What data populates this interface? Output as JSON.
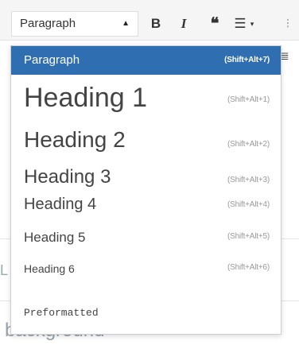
{
  "toolbar": {
    "format_value": "Paragraph",
    "bold_label": "B",
    "italic_label": "I",
    "quote_label": "66",
    "list_label": "☰",
    "list_arrow": "▾",
    "more_label": "⁝"
  },
  "background": {
    "left_chunk": "L",
    "word": "background"
  },
  "dropdown": {
    "items": [
      {
        "label": "Paragraph",
        "shortcut": "(Shift+Alt+7)"
      },
      {
        "label": "Heading 1",
        "shortcut": "(Shift+Alt+1)"
      },
      {
        "label": "Heading 2",
        "shortcut": "(Shift+Alt+2)"
      },
      {
        "label": "Heading 3",
        "shortcut": "(Shift+Alt+3)"
      },
      {
        "label": "Heading 4",
        "shortcut": "(Shift+Alt+4)"
      },
      {
        "label": "Heading 5",
        "shortcut": "(Shift+Alt+5)"
      },
      {
        "label": "Heading 6",
        "shortcut": "(Shift+Alt+6)"
      },
      {
        "label": "Preformatted",
        "shortcut": ""
      }
    ]
  }
}
